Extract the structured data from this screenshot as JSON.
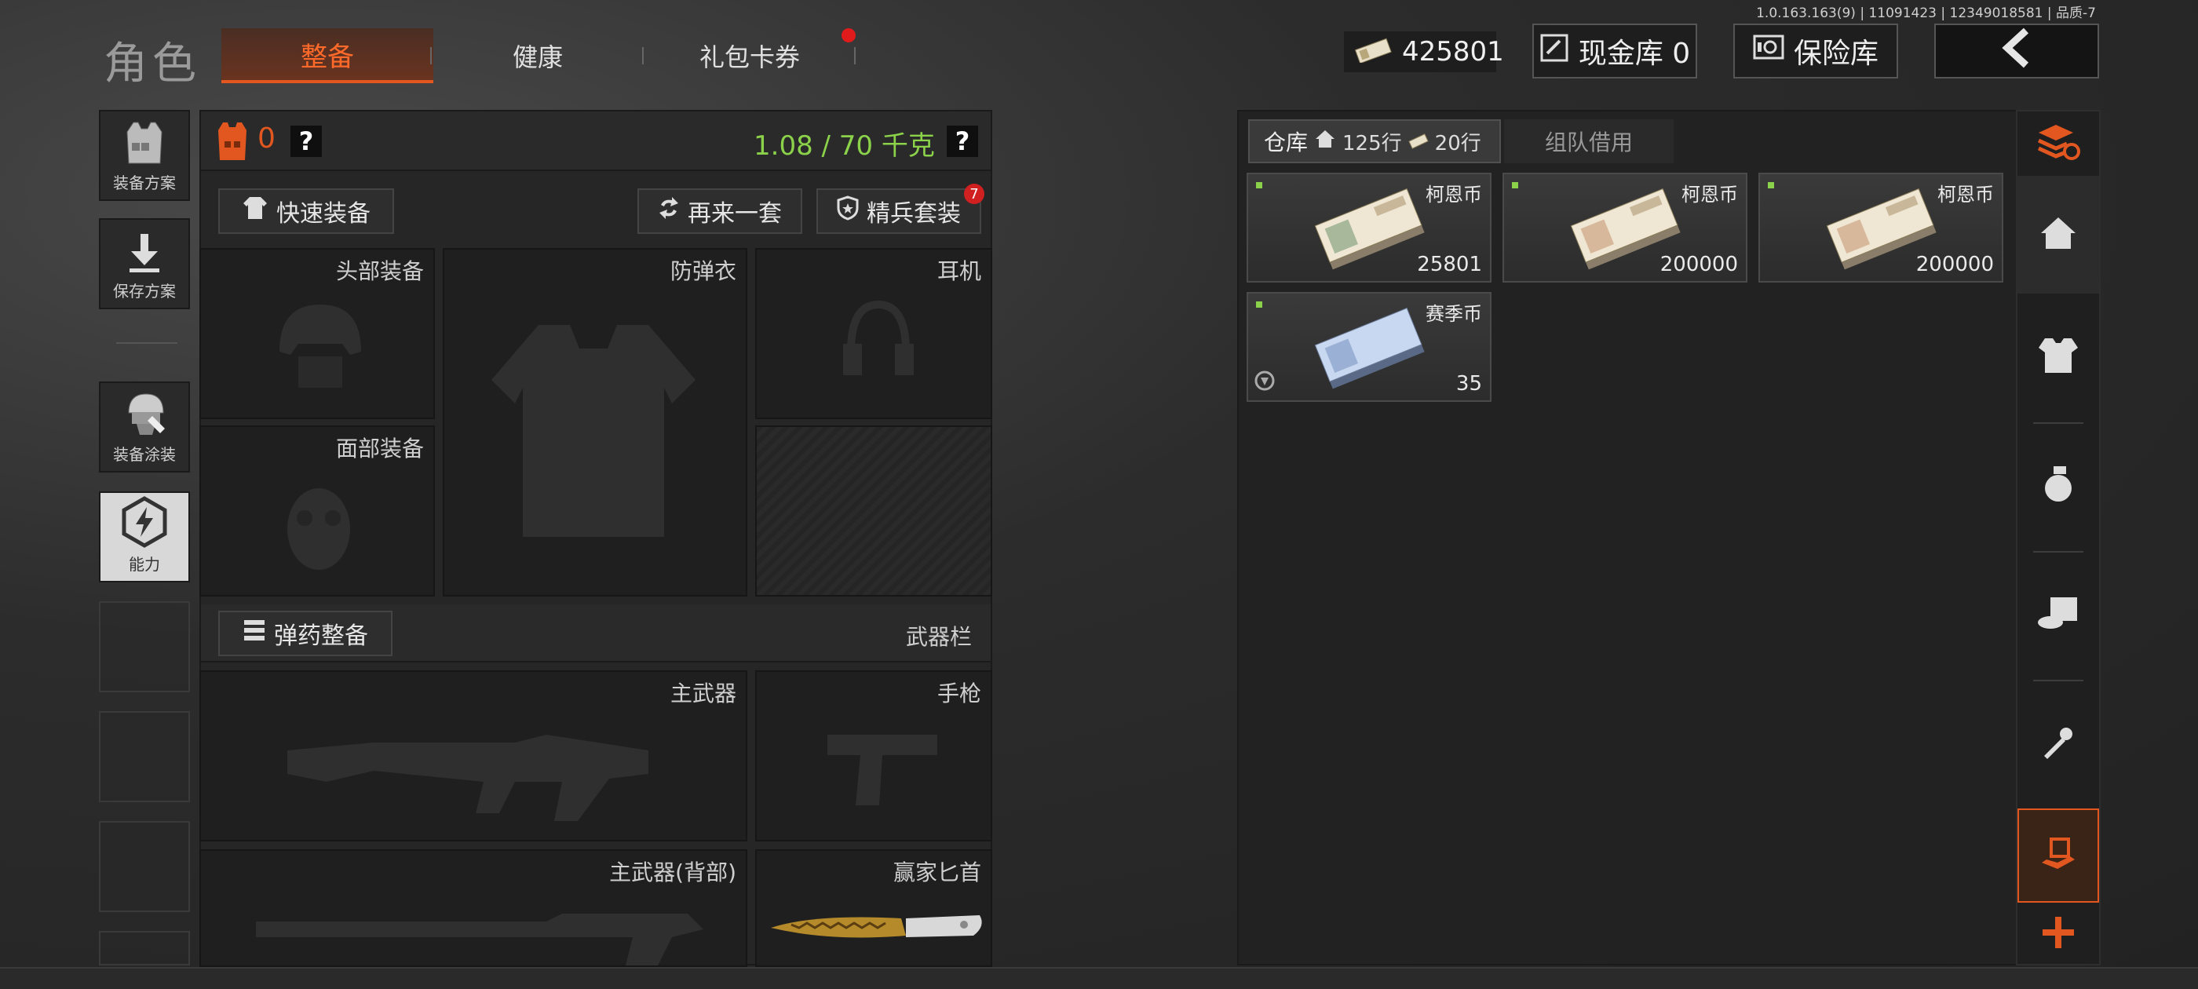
{
  "version_info": "1.0.163.163(9) | 11091423 | 12349018581 | 品质-7",
  "header": {
    "title": "角色",
    "tabs": [
      {
        "label": "整备",
        "active": true
      },
      {
        "label": "健康",
        "active": false
      },
      {
        "label": "礼包卡券",
        "active": false,
        "has_notification": true
      }
    ],
    "money": "425801",
    "cash_vault": "现金库 0",
    "safe_box": "保险库",
    "back_icon": "chevron-left-icon"
  },
  "left_nav": [
    {
      "label": "装备方案",
      "icon": "vest-plan-icon"
    },
    {
      "label": "保存方案",
      "icon": "download-icon"
    },
    {
      "label": "装备涂装",
      "icon": "helmet-paint-icon"
    },
    {
      "label": "能力",
      "icon": "lightning-hex-icon",
      "active": true
    }
  ],
  "loadout": {
    "armor_value": "0",
    "help": "?",
    "weight": "1.08 / 70 千克",
    "quick_equip": "快速装备",
    "again_set": "再来一套",
    "elite_set": "精兵套装",
    "elite_badge": "7",
    "slots": {
      "head": "头部装备",
      "vest": "防弹衣",
      "ear": "耳机",
      "face": "面部装备",
      "primary": "主武器",
      "pistol": "手枪",
      "primary_back": "主武器(背部)",
      "knife": "赢家匕首"
    },
    "ammo_button": "弹药整备",
    "weapon_bar": "武器栏"
  },
  "warehouse": {
    "tab_label": "仓库",
    "rows_home": "125行",
    "rows_money": "20行",
    "team_borrow": "组队借用",
    "items": [
      {
        "name": "柯恩币",
        "count": "25801"
      },
      {
        "name": "柯恩币",
        "count": "200000"
      },
      {
        "name": "柯恩币",
        "count": "200000"
      },
      {
        "name": "赛季币",
        "count": "35"
      }
    ]
  },
  "right_nav": [
    {
      "icon": "refresh-stack-icon"
    },
    {
      "icon": "home-icon"
    },
    {
      "icon": "vest-icon"
    },
    {
      "icon": "grenade-icon"
    },
    {
      "icon": "medkit-icon"
    },
    {
      "icon": "key-icon"
    },
    {
      "icon": "hand-box-icon",
      "active": true
    },
    {
      "icon": "plus-icon"
    }
  ],
  "colors": {
    "accent": "#e2571f",
    "green": "#8bd24a",
    "badge": "#d02020"
  }
}
